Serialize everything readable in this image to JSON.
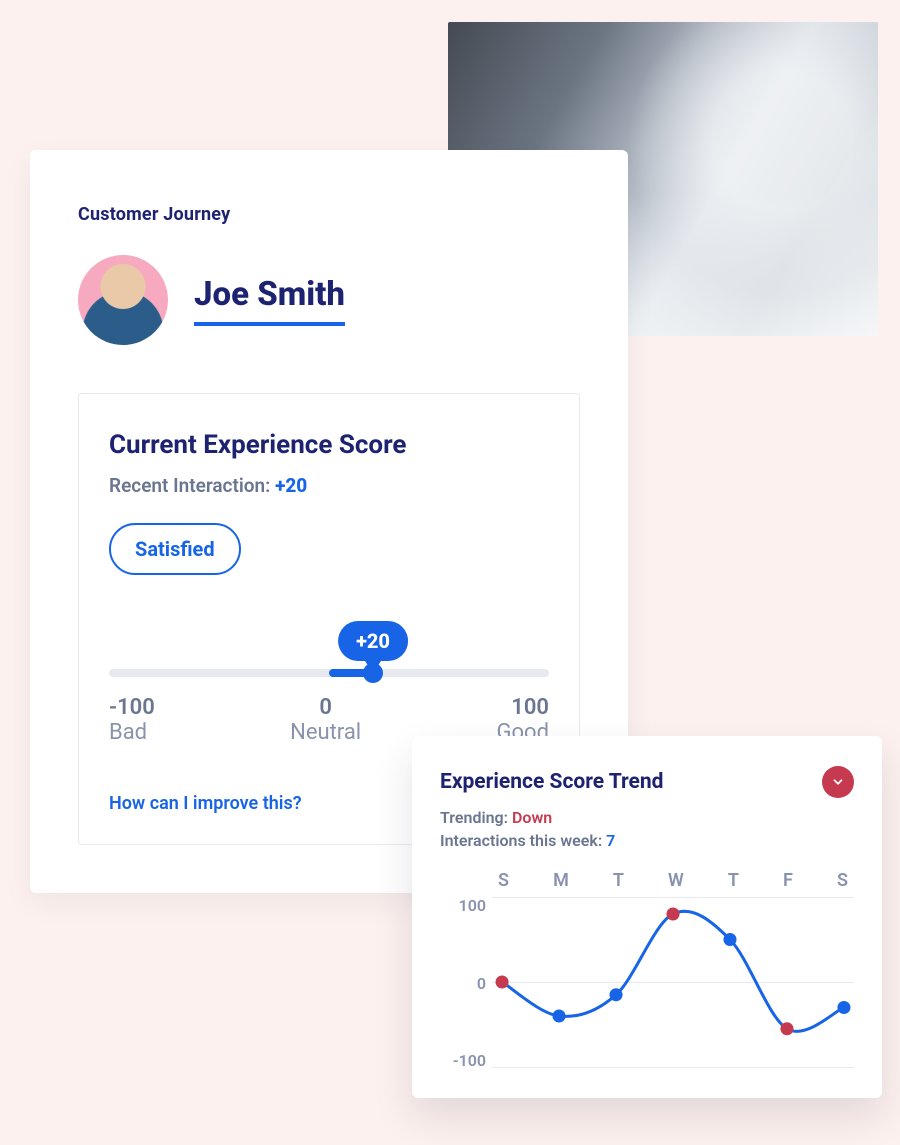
{
  "journey": {
    "section_title": "Customer Journey",
    "customer_name": "Joe Smith"
  },
  "score": {
    "title": "Current Experience Score",
    "recent_label": "Recent Interaction:",
    "recent_value": "+20",
    "status_label": "Satisfied",
    "badge_value": "+20",
    "scale_min": -100,
    "scale_mid": 0,
    "scale_max": 100,
    "scale_min_label": "Bad",
    "scale_mid_label": "Neutral",
    "scale_max_label": "Good",
    "current_value": 20,
    "improve_link_text": "How can I improve this?"
  },
  "trend": {
    "title": "Experience Score Trend",
    "trending_label": "Trending:",
    "trending_value": "Down",
    "interactions_label": "Interactions this week:",
    "interactions_value": "7",
    "y_ticks": [
      "100",
      "0",
      "-100"
    ]
  },
  "chart_data": {
    "type": "line",
    "title": "Experience Score Trend",
    "xlabel": "",
    "ylabel": "",
    "ylim": [
      -100,
      100
    ],
    "categories": [
      "S",
      "M",
      "T",
      "W",
      "T",
      "F",
      "S"
    ],
    "series": [
      {
        "name": "Experience Score",
        "values": [
          0,
          -40,
          -15,
          80,
          50,
          -55,
          -30
        ],
        "point_colors": [
          "red",
          "blue",
          "blue",
          "red",
          "blue",
          "red",
          "blue"
        ]
      }
    ]
  },
  "colors": {
    "primary": "#1765e6",
    "heading": "#1d2371",
    "muted": "#6a7590",
    "danger": "#c63a4f"
  }
}
